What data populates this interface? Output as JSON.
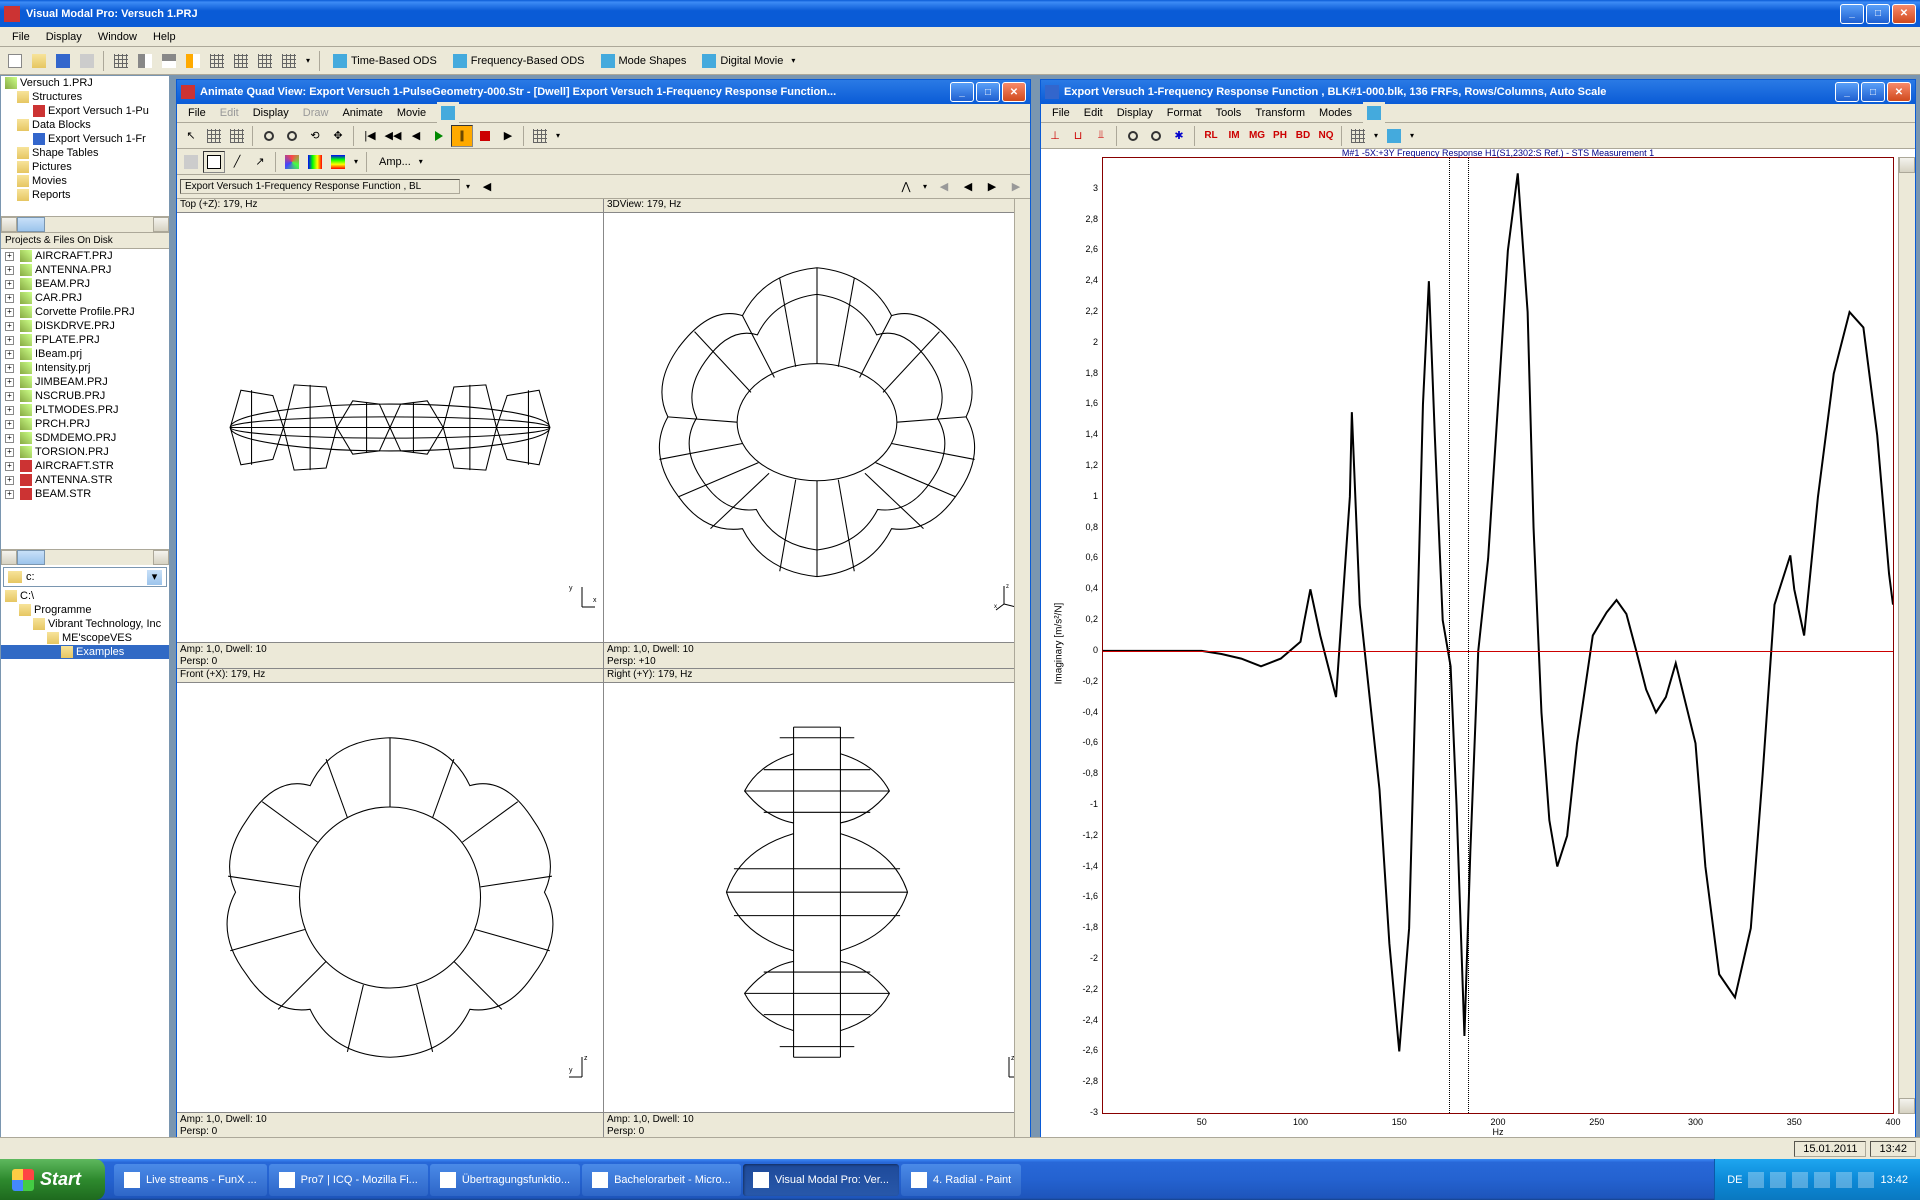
{
  "app": {
    "title": "Visual Modal Pro: Versuch 1.PRJ"
  },
  "menubar": [
    "File",
    "Display",
    "Window",
    "Help"
  ],
  "main_toolbar": {
    "ods_buttons": [
      {
        "name": "time-based-ods",
        "label": "Time-Based ODS"
      },
      {
        "name": "frequency-based-ods",
        "label": "Frequency-Based ODS"
      },
      {
        "name": "mode-shapes",
        "label": "Mode Shapes"
      },
      {
        "name": "digital-movie",
        "label": "Digital Movie"
      }
    ]
  },
  "project_tree": {
    "root": "Versuch 1.PRJ",
    "items": [
      {
        "label": "Structures",
        "icon": "fold",
        "indent": 1
      },
      {
        "label": "Export Versuch 1-Pu",
        "icon": "str",
        "indent": 2
      },
      {
        "label": "Data Blocks",
        "icon": "fold",
        "indent": 1
      },
      {
        "label": "Export Versuch 1-Fr",
        "icon": "dat",
        "indent": 2
      },
      {
        "label": "Shape Tables",
        "icon": "fold",
        "indent": 1
      },
      {
        "label": "Pictures",
        "icon": "fold",
        "indent": 1
      },
      {
        "label": "Movies",
        "icon": "fold",
        "indent": 1
      },
      {
        "label": "Reports",
        "icon": "fold",
        "indent": 1
      }
    ]
  },
  "files_panel": {
    "header": "Projects & Files On Disk",
    "items": [
      "AIRCRAFT.PRJ",
      "ANTENNA.PRJ",
      "BEAM.PRJ",
      "CAR.PRJ",
      "Corvette Profile.PRJ",
      "DISKDRVE.PRJ",
      "FPLATE.PRJ",
      "IBeam.prj",
      "Intensity.prj",
      "JIMBEAM.PRJ",
      "NSCRUB.PRJ",
      "PLTMODES.PRJ",
      "PRCH.PRJ",
      "SDMDEMO.PRJ",
      "TORSION.PRJ",
      "AIRCRAFT.STR",
      "ANTENNA.STR",
      "BEAM.STR"
    ]
  },
  "drive_combo": "c:",
  "folder_tree": {
    "items": [
      {
        "label": "C:\\",
        "indent": 0
      },
      {
        "label": "Programme",
        "indent": 1
      },
      {
        "label": "Vibrant Technology, Inc",
        "indent": 2
      },
      {
        "label": "ME'scopeVES",
        "indent": 3
      },
      {
        "label": "Examples",
        "indent": 4,
        "selected": true
      }
    ]
  },
  "animate_window": {
    "title": "Animate Quad View: Export Versuch 1-PulseGeometry-000.Str - [Dwell] Export Versuch 1-Frequency Response Function...",
    "menubar": [
      "File",
      "Edit",
      "Display",
      "Draw",
      "Animate",
      "Movie"
    ],
    "source_dropdown": "Export Versuch 1-Frequency Response Function , BL",
    "amp_dropdown": "Amp...",
    "panes": {
      "top": {
        "header": "Top (+Z): 179, Hz",
        "footer1": "Amp: 1,0,  Dwell: 10",
        "footer2": "Persp: 0"
      },
      "view3d": {
        "header": "3DView: 179, Hz",
        "footer1": "Amp: 1,0,  Dwell: 10",
        "footer2": "Persp: +10"
      },
      "front": {
        "header": "Front (+X): 179, Hz",
        "footer1": "Amp: 1,0,  Dwell: 10",
        "footer2": "Persp: 0"
      },
      "right": {
        "header": "Right (+Y): 179, Hz",
        "footer1": "Amp: 1,0,  Dwell: 10",
        "footer2": "Persp: 0"
      }
    }
  },
  "chart_window": {
    "title": "Export Versuch 1-Frequency Response Function , BLK#1-000.blk, 136 FRFs, Rows/Columns, Auto Scale",
    "menubar": [
      "File",
      "Edit",
      "Display",
      "Format",
      "Tools",
      "Transform",
      "Modes"
    ],
    "toolbar_red": [
      "RL",
      "IM",
      "MG",
      "PH",
      "BD",
      "NQ"
    ],
    "plot_title": "M#1  -5X:+3Y Frequency Response H1(S1,2302:S Ref.) - STS Measurement 1",
    "ylabel": "Imaginary [m/s²/N]",
    "xlabel": "Hz"
  },
  "chart_data": {
    "type": "line",
    "title": "M#1 -5X:+3Y Frequency Response H1(S1,2302:S Ref.) - STS Measurement 1",
    "xlabel": "Hz",
    "ylabel": "Imaginary [m/s²/N]",
    "xlim": [
      0,
      400
    ],
    "ylim": [
      -3.0,
      3.2
    ],
    "xticks": [
      50,
      100,
      150,
      200,
      250,
      300,
      350,
      400
    ],
    "yticks": [
      3.0,
      2.8,
      2.6,
      2.4,
      2.2,
      2.0,
      1.8,
      1.6,
      1.4,
      1.2,
      1.0,
      0.8,
      0.6,
      0.4,
      0.2,
      0,
      -0.2,
      -0.4,
      -0.6,
      -0.8,
      -1.0,
      -1.2,
      -1.4,
      -1.6,
      -1.8,
      -2.0,
      -2.2,
      -2.4,
      -2.6,
      -2.8,
      -3.0
    ],
    "cursors_x": [
      175,
      185
    ],
    "series": [
      {
        "name": "FRF Imaginary",
        "x": [
          0,
          25,
          50,
          60,
          70,
          80,
          90,
          100,
          102,
          105,
          110,
          118,
          125,
          126,
          130,
          135,
          140,
          145,
          150,
          155,
          160,
          162,
          165,
          168,
          172,
          176,
          179,
          183,
          186,
          190,
          195,
          200,
          205,
          210,
          215,
          218,
          222,
          226,
          230,
          235,
          240,
          248,
          255,
          260,
          265,
          270,
          275,
          280,
          285,
          290,
          300,
          305,
          312,
          320,
          328,
          334,
          340,
          348,
          350,
          355,
          362,
          370,
          378,
          385,
          392,
          398,
          400
        ],
        "y": [
          0.0,
          0.0,
          0.0,
          -0.02,
          -0.05,
          -0.1,
          -0.05,
          0.06,
          0.2,
          0.4,
          0.1,
          -0.3,
          1.0,
          1.55,
          0.3,
          -0.3,
          -0.9,
          -1.9,
          -2.6,
          -1.8,
          0.6,
          1.6,
          2.4,
          1.4,
          0.2,
          -0.1,
          -1.0,
          -2.5,
          -1.3,
          0.0,
          0.6,
          1.6,
          2.6,
          3.1,
          2.2,
          0.8,
          -0.4,
          -1.1,
          -1.4,
          -1.2,
          -0.6,
          0.1,
          0.25,
          0.33,
          0.24,
          0.0,
          -0.25,
          -0.4,
          -0.3,
          -0.08,
          -0.6,
          -1.4,
          -2.1,
          -2.25,
          -1.8,
          -0.8,
          0.3,
          0.62,
          0.4,
          0.1,
          1.0,
          1.8,
          2.2,
          2.1,
          1.4,
          0.5,
          0.3
        ]
      }
    ]
  },
  "statusbar": {
    "date": "15.01.2011",
    "time_status": "13:42"
  },
  "taskbar": {
    "start": "Start",
    "items": [
      {
        "label": "Live streams - FunX ...",
        "active": false
      },
      {
        "label": "Pro7 | ICQ - Mozilla Fi...",
        "active": false
      },
      {
        "label": "Übertragungsfunktio...",
        "active": false
      },
      {
        "label": "Bachelorarbeit - Micro...",
        "active": false
      },
      {
        "label": "Visual Modal Pro: Ver...",
        "active": true
      },
      {
        "label": "4. Radial - Paint",
        "active": false
      }
    ],
    "tray": {
      "lang": "DE",
      "time": "13:42"
    }
  }
}
